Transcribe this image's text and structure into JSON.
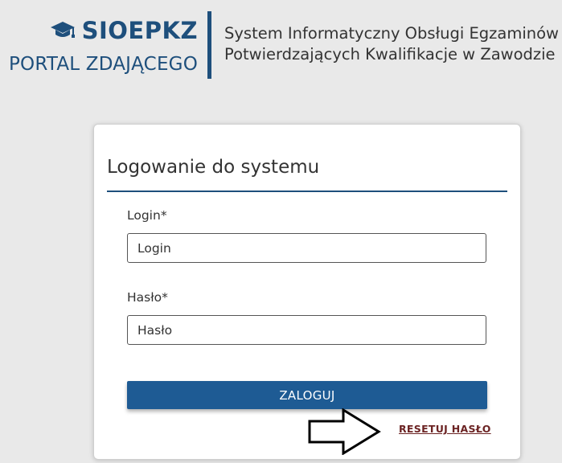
{
  "header": {
    "brand_name": "SIOEPKZ",
    "brand_subtitle": "PORTAL ZDAJĄCEGO",
    "system_title_line1": "System Informatyczny Obsługi Egzaminów",
    "system_title_line2": "Potwierdzających Kwalifikacje w Zawodzie",
    "logo_icon": "graduation-cap-icon"
  },
  "login_form": {
    "title": "Logowanie do systemu",
    "login_label": "Login*",
    "login_placeholder": "Login",
    "login_value": "",
    "password_label": "Hasło*",
    "password_placeholder": "Hasło",
    "password_value": "",
    "submit_label": "ZALOGUJ",
    "reset_link_label": "RESETUJ HASŁO"
  },
  "annotation": {
    "arrow_icon": "right-arrow-outline-icon"
  },
  "colors": {
    "brand": "#1e4f7c",
    "button": "#1e5b94",
    "link": "#6b2323",
    "background": "#e9e9e9"
  }
}
